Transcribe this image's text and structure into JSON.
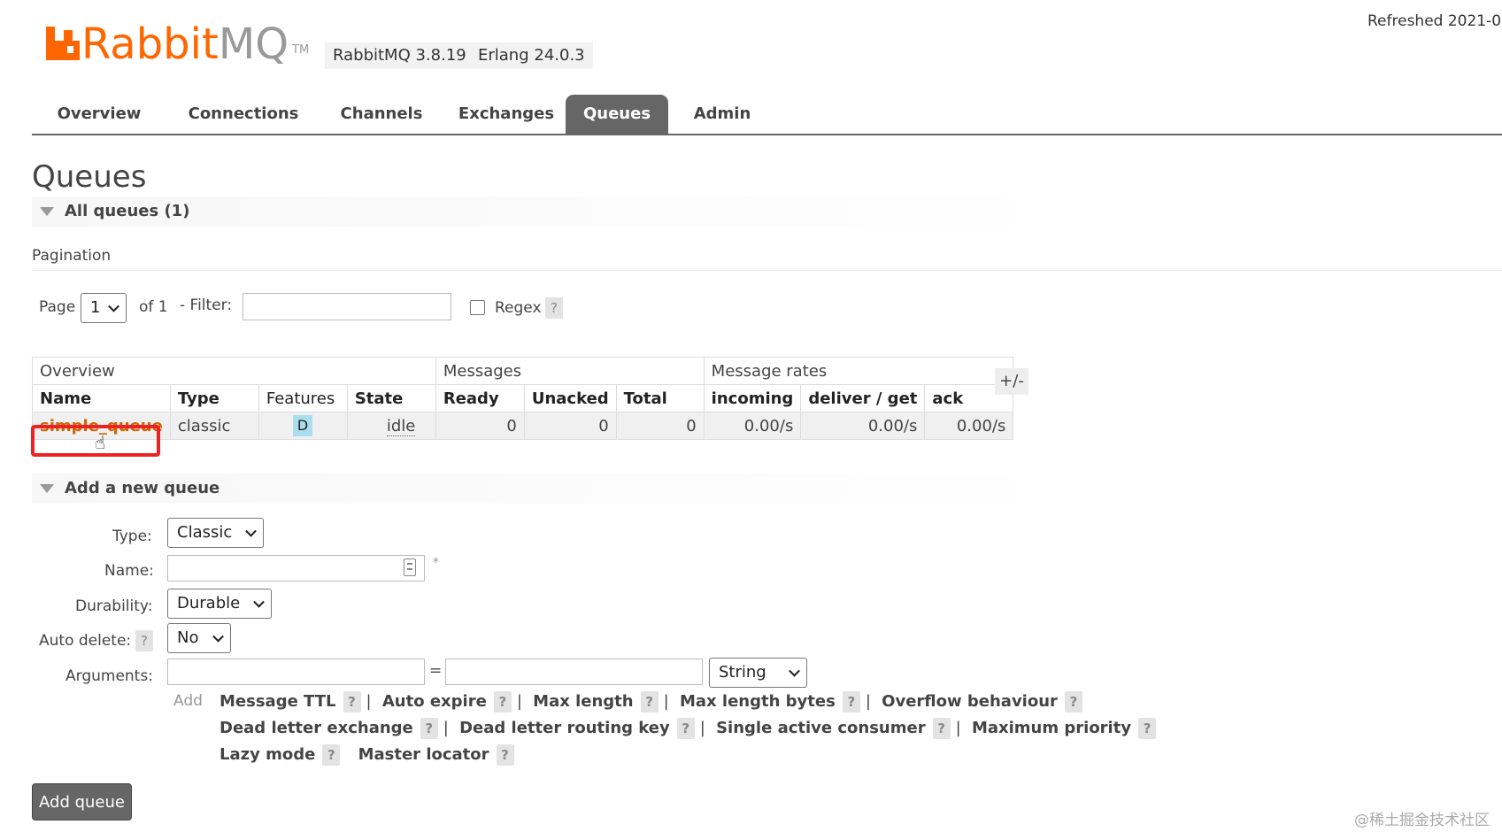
{
  "header": {
    "logo_a": "Rabbit",
    "logo_b": "MQ",
    "logo_tm": "TM",
    "version": "RabbitMQ 3.8.19",
    "erlang": "Erlang 24.0.3",
    "refreshed": "Refreshed 2021-0"
  },
  "nav": {
    "tabs": [
      {
        "label": "Overview"
      },
      {
        "label": "Connections"
      },
      {
        "label": "Channels"
      },
      {
        "label": "Exchanges"
      },
      {
        "label": "Queues"
      },
      {
        "label": "Admin"
      }
    ],
    "active": "Queues"
  },
  "page": {
    "title": "Queues",
    "all_queues": "All queues (1)"
  },
  "pagination": {
    "title": "Pagination",
    "page_label": "Page",
    "page_value": "1",
    "of_label": "of 1",
    "filter_label": "- Filter:",
    "filter_value": "",
    "regex_label": "Regex",
    "help": "?"
  },
  "table": {
    "groups": [
      "Overview",
      "Messages",
      "Message rates"
    ],
    "columns": [
      "Name",
      "Type",
      "Features",
      "State",
      "Ready",
      "Unacked",
      "Total",
      "incoming",
      "deliver / get",
      "ack"
    ],
    "rows": [
      {
        "name": "simple_queue",
        "type": "classic",
        "features": "D",
        "state": "idle",
        "ready": "0",
        "unacked": "0",
        "total": "0",
        "incoming": "0.00/s",
        "deliver_get": "0.00/s",
        "ack": "0.00/s"
      }
    ],
    "toggle": "+/-"
  },
  "add_queue": {
    "heading": "Add a new queue",
    "type_label": "Type:",
    "type_value": "Classic",
    "name_label": "Name:",
    "name_value": "",
    "required_mark": "*",
    "durability_label": "Durability:",
    "durability_value": "Durable",
    "auto_delete_label": "Auto delete:",
    "auto_delete_value": "No",
    "arguments_label": "Arguments:",
    "equals": "=",
    "arg_type_value": "String",
    "add_label": "Add",
    "arg_links": {
      "message_ttl": "Message TTL",
      "auto_expire": "Auto expire",
      "max_length": "Max length",
      "max_length_bytes": "Max length bytes",
      "overflow": "Overflow behaviour",
      "dead_letter_exchange": "Dead letter exchange",
      "dead_letter_routing_key": "Dead letter routing key",
      "single_active_consumer": "Single active consumer",
      "maximum_priority": "Maximum priority",
      "lazy_mode": "Lazy mode",
      "master_locator": "Master locator"
    },
    "sep": "|",
    "submit": "Add queue"
  },
  "watermark": "@稀土掘金技术社区",
  "icons": {
    "cursor": "hand-pointer-icon",
    "name_field": "keyboard-icon"
  }
}
